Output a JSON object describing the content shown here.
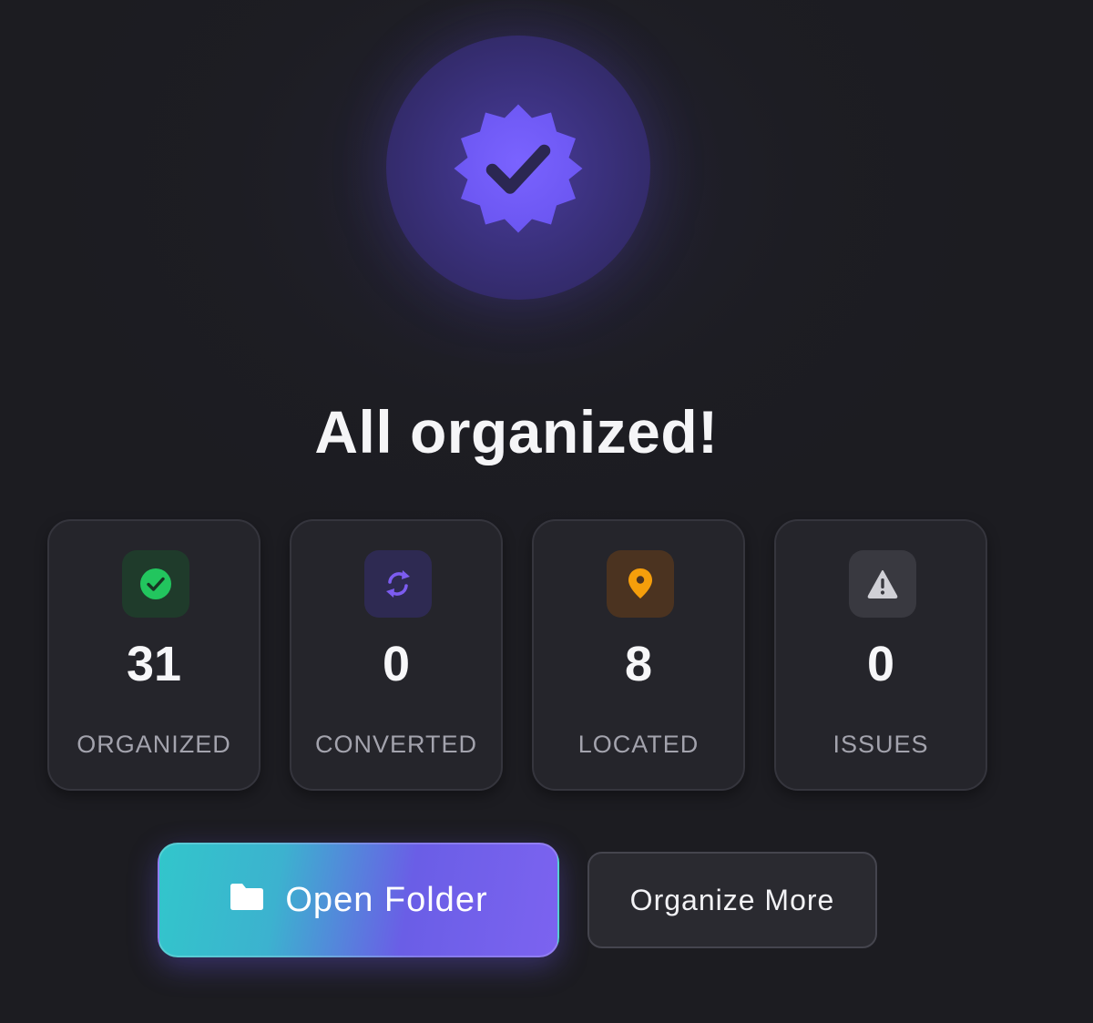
{
  "hero": {
    "icon": "verified-badge-icon",
    "title": "All organized!"
  },
  "stats": [
    {
      "icon": "check-circle-icon",
      "value": "31",
      "label": "ORGANIZED",
      "accent": "#22c55e"
    },
    {
      "icon": "refresh-icon",
      "value": "0",
      "label": "CONVERTED",
      "accent": "#7c5cf0"
    },
    {
      "icon": "location-pin-icon",
      "value": "8",
      "label": "LOCATED",
      "accent": "#f59e0b"
    },
    {
      "icon": "warning-icon",
      "value": "0",
      "label": "ISSUES",
      "accent": "#c9c9cf"
    }
  ],
  "actions": {
    "primary": {
      "icon": "folder-icon",
      "label": "Open Folder"
    },
    "secondary": {
      "label": "Organize More"
    }
  },
  "colors": {
    "background": "#1c1c21",
    "brand_purple": "#6c58e8",
    "brand_teal": "#32c6cb"
  }
}
